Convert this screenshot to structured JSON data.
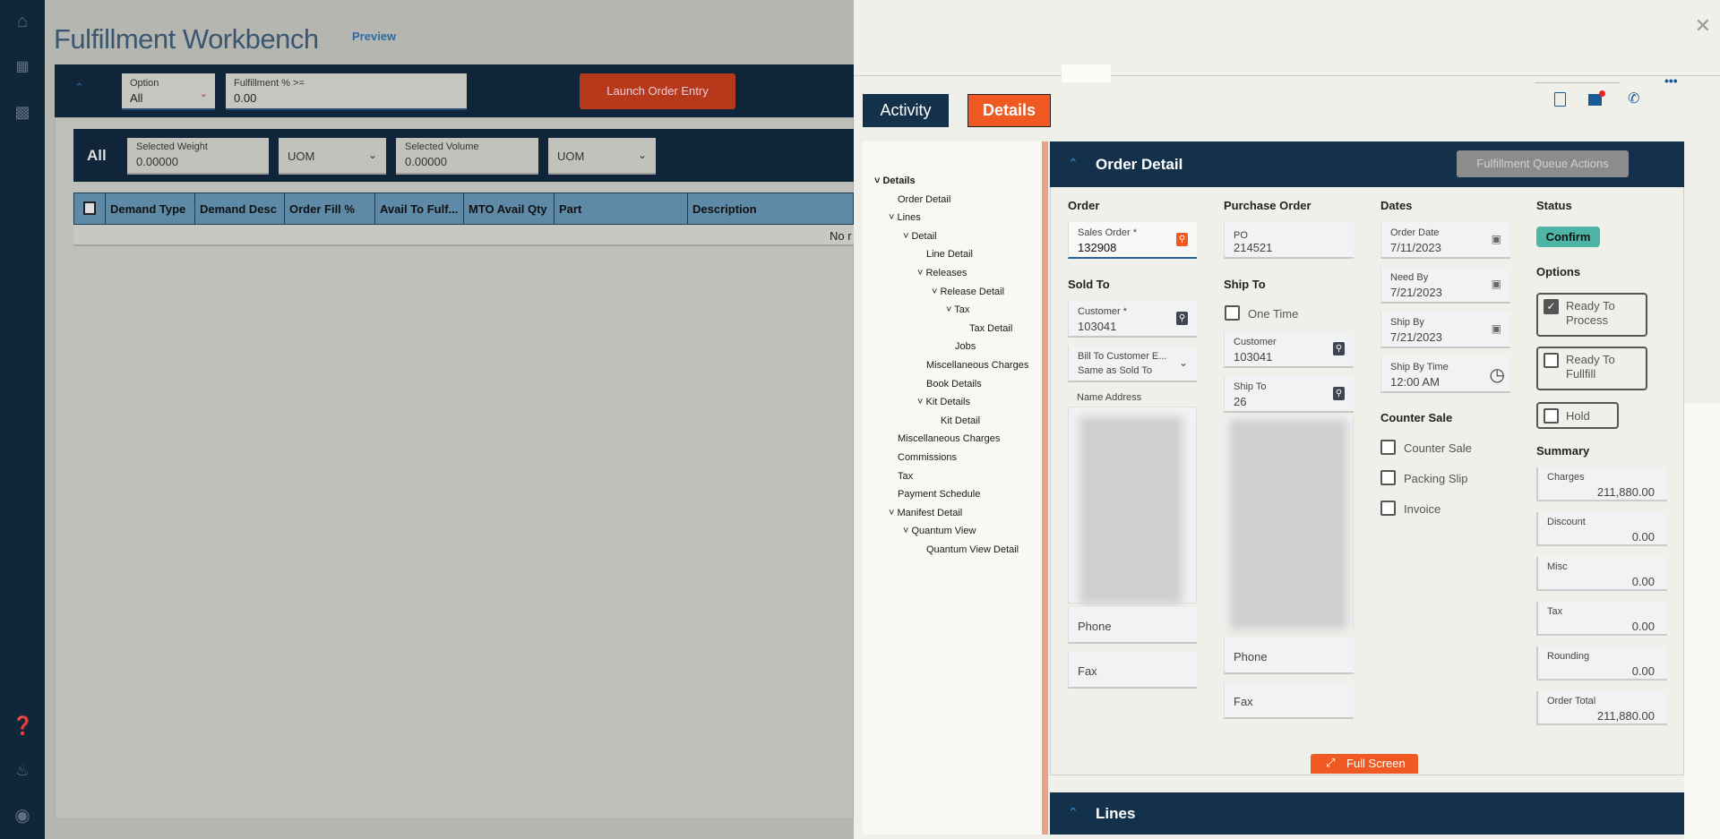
{
  "sidebar": {
    "icons": [
      "home-icon",
      "apps-grid-icon",
      "dashboard-icon",
      "help-icon",
      "bell-icon",
      "user-icon"
    ]
  },
  "page": {
    "title": "Fulfillment Workbench",
    "badge": "Preview"
  },
  "filters": {
    "option_label": "Option",
    "option_value": "All",
    "fulfillment_label": "Fulfillment % >=",
    "fulfillment_value": "0.00",
    "launch_button": "Launch Order Entry"
  },
  "grid_toolbar": {
    "title": "All",
    "weight_label": "Selected Weight",
    "weight_value": "0.00000",
    "uom1": "UOM",
    "volume_label": "Selected Volume",
    "volume_value": "0.00000",
    "uom2": "UOM"
  },
  "table": {
    "columns": [
      "Demand Type",
      "Demand Desc",
      "Order Fill %",
      "Avail To Fulf...",
      "MTO Avail Qty",
      "Part",
      "Description"
    ],
    "empty_text": "No r"
  },
  "panel": {
    "tabs": [
      "Activity",
      "Details"
    ],
    "active_tab": "Details",
    "tree": [
      {
        "label": "Details",
        "level": 0,
        "expanded": true,
        "bold": true
      },
      {
        "label": "Order Detail",
        "level": 1
      },
      {
        "label": "Lines",
        "level": 1,
        "expanded": true
      },
      {
        "label": "Detail",
        "level": 2,
        "expanded": true
      },
      {
        "label": "Line Detail",
        "level": 3
      },
      {
        "label": "Releases",
        "level": 3,
        "expanded": true
      },
      {
        "label": "Release Detail",
        "level": 4,
        "expanded": true
      },
      {
        "label": "Tax",
        "level": 5,
        "expanded": true
      },
      {
        "label": "Tax Detail",
        "level": 6
      },
      {
        "label": "Jobs",
        "level": 5
      },
      {
        "label": "Miscellaneous Charges",
        "level": 3
      },
      {
        "label": "Book Details",
        "level": 3
      },
      {
        "label": "Kit Details",
        "level": 3,
        "expanded": true
      },
      {
        "label": "Kit Detail",
        "level": 4
      },
      {
        "label": "Miscellaneous Charges",
        "level": 1
      },
      {
        "label": "Commissions",
        "level": 1
      },
      {
        "label": "Tax",
        "level": 1
      },
      {
        "label": "Payment Schedule",
        "level": 1
      },
      {
        "label": "Manifest Detail",
        "level": 1,
        "expanded": true
      },
      {
        "label": "Quantum View",
        "level": 2,
        "expanded": true
      },
      {
        "label": "Quantum View Detail",
        "level": 3
      }
    ],
    "order_detail": {
      "title": "Order Detail",
      "queue_button": "Fulfillment Queue Actions",
      "order": {
        "heading": "Order",
        "sales_order_label": "Sales Order *",
        "sales_order": "132908"
      },
      "sold_to": {
        "heading": "Sold To",
        "customer_label": "Customer *",
        "customer": "103041",
        "bill_to_label": "Bill To Customer E...",
        "bill_to": "Same as Sold To",
        "name_address_label": "Name Address",
        "phone_label": "Phone",
        "fax_label": "Fax"
      },
      "purchase_order": {
        "heading": "Purchase Order",
        "po_label": "PO",
        "po": "214521"
      },
      "ship_to": {
        "heading": "Ship To",
        "one_time_label": "One Time",
        "one_time": false,
        "customer_label": "Customer",
        "customer": "103041",
        "ship_to_label": "Ship To",
        "ship_to": "26",
        "phone_label": "Phone",
        "fax_label": "Fax"
      },
      "dates": {
        "heading": "Dates",
        "order_date_label": "Order Date",
        "order_date": "7/11/2023",
        "need_by_label": "Need By",
        "need_by": "7/21/2023",
        "ship_by_label": "Ship By",
        "ship_by": "7/21/2023",
        "ship_time_label": "Ship By Time",
        "ship_time": "12:00 AM"
      },
      "counter_sale": {
        "heading": "Counter Sale",
        "items": [
          {
            "label": "Counter Sale",
            "checked": false
          },
          {
            "label": "Packing Slip",
            "checked": false
          },
          {
            "label": "Invoice",
            "checked": false
          }
        ]
      },
      "status": {
        "heading": "Status",
        "value": "Confirm",
        "color": "#4cb5a5"
      },
      "options": {
        "heading": "Options",
        "ready_process_1": "Ready To",
        "ready_process_2": "Process",
        "ready_process": true,
        "ready_fulfill_1": "Ready To",
        "ready_fulfill_2": "Fullfill",
        "ready_fulfill": false,
        "hold": "Hold",
        "hold_checked": false
      },
      "summary": {
        "heading": "Summary",
        "items": [
          {
            "label": "Charges",
            "value": "211,880.00"
          },
          {
            "label": "Discount",
            "value": "0.00"
          },
          {
            "label": "Misc",
            "value": "0.00"
          },
          {
            "label": "Tax",
            "value": "0.00"
          },
          {
            "label": "Rounding",
            "value": "0.00"
          },
          {
            "label": "Order Total",
            "value": "211,880.00"
          }
        ]
      },
      "full_screen": "Full Screen"
    },
    "lines_title": "Lines"
  },
  "colors": {
    "navy": "#13314a",
    "accent": "#f05a22",
    "teal": "#4cb5a5"
  }
}
